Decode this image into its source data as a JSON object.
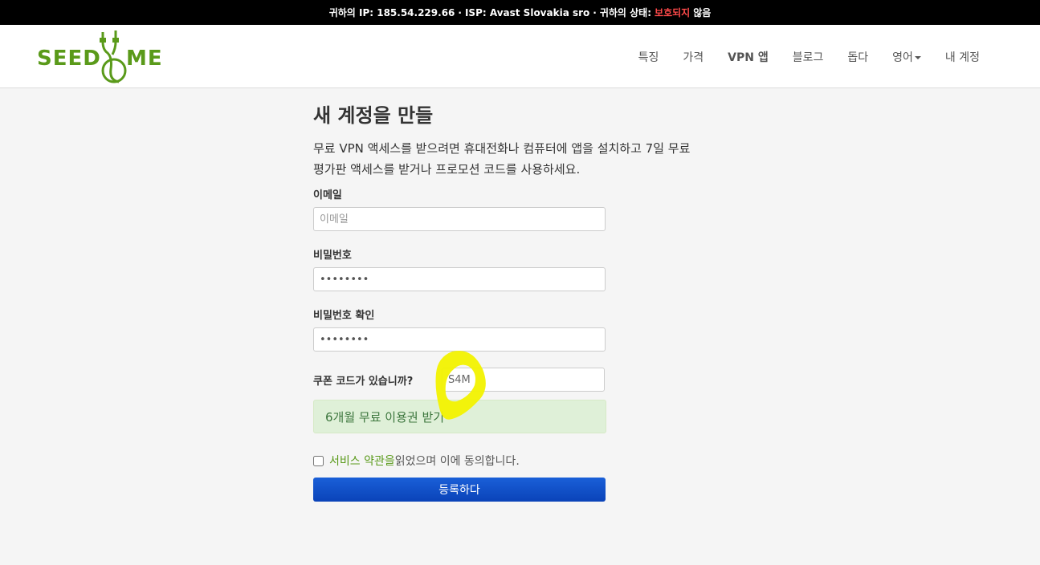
{
  "topbar": {
    "ip_label": "귀하의 IP: 185.54.229.66",
    "separator1": "·",
    "isp_label": "ISP: Avast Slovakia sro",
    "separator2": "·",
    "status_label": "귀하의 상태:",
    "status_warning": "보호되지",
    "status_suffix": "않음"
  },
  "logo": {
    "left": "SEED",
    "right": "ME"
  },
  "nav": {
    "items": [
      "특징",
      "가격",
      "VPN 앱",
      "블로그",
      "돕다",
      "영어",
      "내 계정"
    ]
  },
  "page": {
    "title": "새 계정을 만들",
    "intro": "무료 VPN 액세스를 받으려면 휴대전화나 컴퓨터에 앱을 설치하고 7일 무료 평가판 액세스를 받거나 프로모션 코드를 사용하세요."
  },
  "form": {
    "email_label": "이메일",
    "email_placeholder": "이메일",
    "password_label": "비밀번호",
    "password_value": "••••••••",
    "confirm_label": "비밀번호 확인",
    "confirm_value": "••••••••",
    "coupon_label": "쿠폰 코드가 있습니까?",
    "coupon_value": "S4M",
    "success_message": "6개월 무료 이용권 받기",
    "terms_link": "서비스 약관을",
    "terms_suffix": " 읽었으며 이에 동의합니다.",
    "submit_label": "등록하다"
  },
  "colors": {
    "brand_green": "#5a9a1a",
    "button_blue": "#0a4fcc",
    "success_bg": "#dff0d8",
    "highlight": "#f2f200"
  }
}
